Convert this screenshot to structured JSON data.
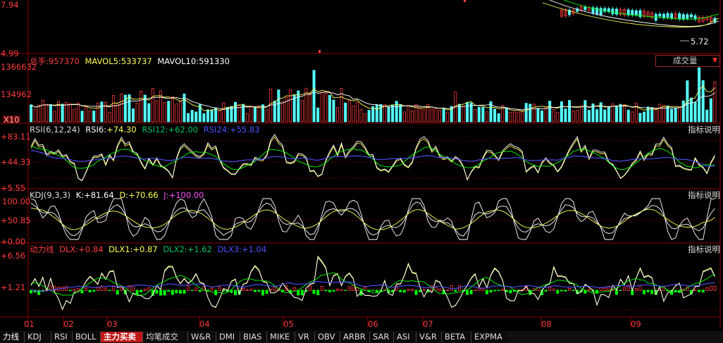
{
  "price_pane": {
    "y_top": "7.94",
    "y_bottom": "4.99",
    "low_marker": "5.72"
  },
  "volume_pane": {
    "title_prefix": "总手:",
    "total": "957370",
    "mavol5_label": "MAVOL5:",
    "mavol5": "533737",
    "mavol10_label": "MAVOL10:",
    "mavol10": "591330",
    "y_top": "1366632",
    "y_mid": "134962",
    "y_unit": "X10",
    "dropdown_label": "成交量"
  },
  "rsi_pane": {
    "title": "RSI(6,12,24)",
    "rsi6_label": "RSI6:",
    "rsi6": "+74.30",
    "rsi12_label": "RSI12:",
    "rsi12": "+62.00",
    "rsi24_label": "RSI24:",
    "rsi24": "+55.83",
    "y_top": "+83.11",
    "y_mid": "+44.33",
    "y_bottom": "+5.55",
    "help": "指标说明"
  },
  "kdj_pane": {
    "title": "KDJ(9,3,3)",
    "k_label": "K:",
    "k": "+81.64",
    "d_label": "D:",
    "d": "+70.66",
    "j_label": "J:",
    "j": "+100.00",
    "y_top": "100.00",
    "y_mid": "+50.85",
    "y_bottom": "+0.00",
    "help": "指标说明"
  },
  "dlx_pane": {
    "title": "动力线",
    "dlx_label": "DLX:",
    "dlx": "+0.84",
    "dlx1_label": "DLX1:",
    "dlx1": "+0.87",
    "dlx2_label": "DLX2:",
    "dlx2": "+1.62",
    "dlx3_label": "DLX3:",
    "dlx3": "+1.04",
    "y_top": "+6.56",
    "y_mid": "+1.21",
    "help": "指标说明"
  },
  "x_axis": {
    "months": [
      "01",
      "02",
      "03",
      "04",
      "05",
      "06",
      "07",
      "08",
      "09"
    ]
  },
  "tabs": [
    "力线",
    "KDJ",
    "RSI",
    "BOLL",
    "主力买卖",
    "均笔成交",
    "W&R",
    "DMI",
    "BIAS",
    "MIKE",
    "VR",
    "OBV",
    "ARBR",
    "SAR",
    "ASI",
    "V&R",
    "BETA",
    "EXPMA"
  ],
  "active_tab": "主力买卖",
  "colors": {
    "grid": "#8b0000",
    "up": "#ff3c3c",
    "down": "#54ffff",
    "white_line": "#ffffff",
    "yellow_line": "#ffff54",
    "green_line": "#00ff00",
    "blue_line": "#5050ff",
    "magenta_line": "#ff54ff"
  }
}
